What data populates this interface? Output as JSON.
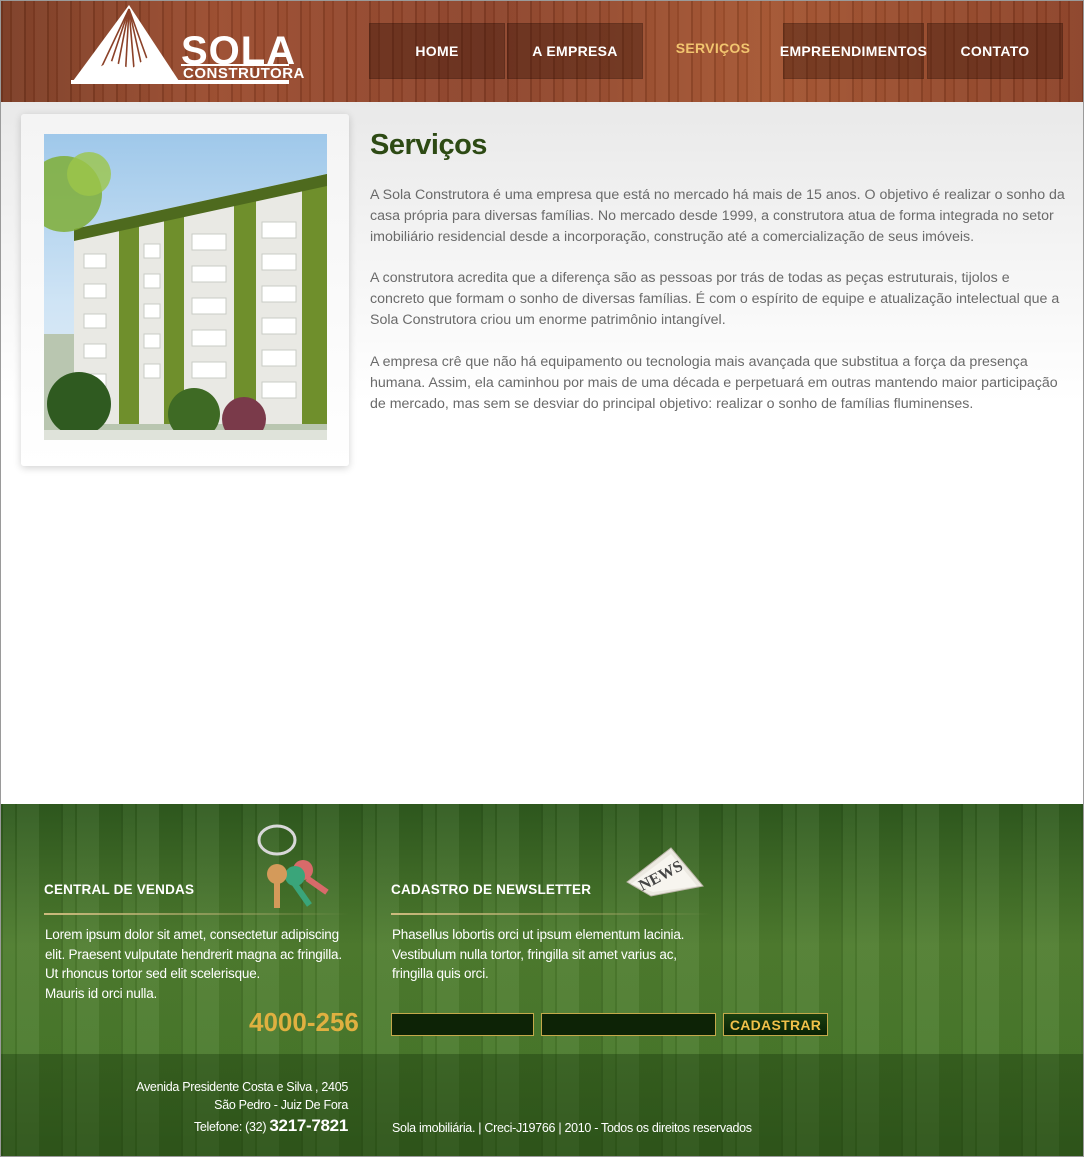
{
  "logo": {
    "word": "SOLA",
    "sub": "CONSTRUTORA"
  },
  "nav": {
    "items": [
      {
        "label": "HOME"
      },
      {
        "label": "A EMPRESA"
      },
      {
        "label": "SERVIÇOS"
      },
      {
        "label": "EMPREENDIMENTOS"
      },
      {
        "label": "CONTATO"
      }
    ],
    "active": "SERVIÇOS"
  },
  "main": {
    "title": "Serviços",
    "paragraphs": [
      "A Sola Construtora é uma empresa que está no mercado há mais de 15 anos. O objetivo é realizar o sonho da casa própria para diversas famílias. No mercado desde 1999, a construtora atua de forma integrada no setor imobiliário residencial desde a incorporação, construção até a comercialização de seus imóveis.",
      "A construtora acredita que a diferença são as pessoas por trás de todas as peças estruturais, tijolos e concreto que formam o sonho de diversas famílias. É com o espírito de equipe e atualização intelectual que a Sola Construtora criou um enorme patrimônio intangível.",
      "A empresa crê que não há equipamento ou tecnologia mais avançada que substitua a força da presença humana. Assim, ela caminhou por mais de uma década e perpetuará em outras mantendo maior participação de mercado, mas sem se desviar do principal objetivo: realizar o sonho de famílias fluminenses."
    ]
  },
  "footer": {
    "sales": {
      "heading": "CENTRAL DE VENDAS",
      "lines": [
        "Lorem ipsum dolor sit amet, consectetur adipiscing",
        "elit. Praesent vulputate hendrerit magna ac fringilla.",
        "Ut rhoncus tortor sed elit scelerisque.",
        "Mauris id orci nulla."
      ],
      "phone": "4000-256"
    },
    "newsletter": {
      "heading": "CADASTRO DE NEWSLETTER",
      "lines": [
        "Phasellus lobortis orci ut ipsum elementum lacinia.",
        "Vestibulum nulla tortor, fringilla sit amet varius ac,",
        "fringilla quis orci."
      ],
      "name_value": "",
      "email_value": "",
      "button": "CADASTRAR",
      "news_badge": "NEWS"
    },
    "address": {
      "street": "Avenida Presidente Costa e Silva ,  2405",
      "city": "São Pedro  - Juiz De Fora",
      "tel_label": "Telefone: (32)",
      "tel_number": "3217-7821"
    },
    "copyright": "Sola imobiliária. | Creci-J19766 | 2010 - Todos os direitos reservados"
  },
  "colors": {
    "header_wood": "#8b4128",
    "footer_wood": "#4a7a2c",
    "title_green": "#2d4a14",
    "nav_active": "#f2c56f",
    "phone_gold": "#e0b040"
  }
}
